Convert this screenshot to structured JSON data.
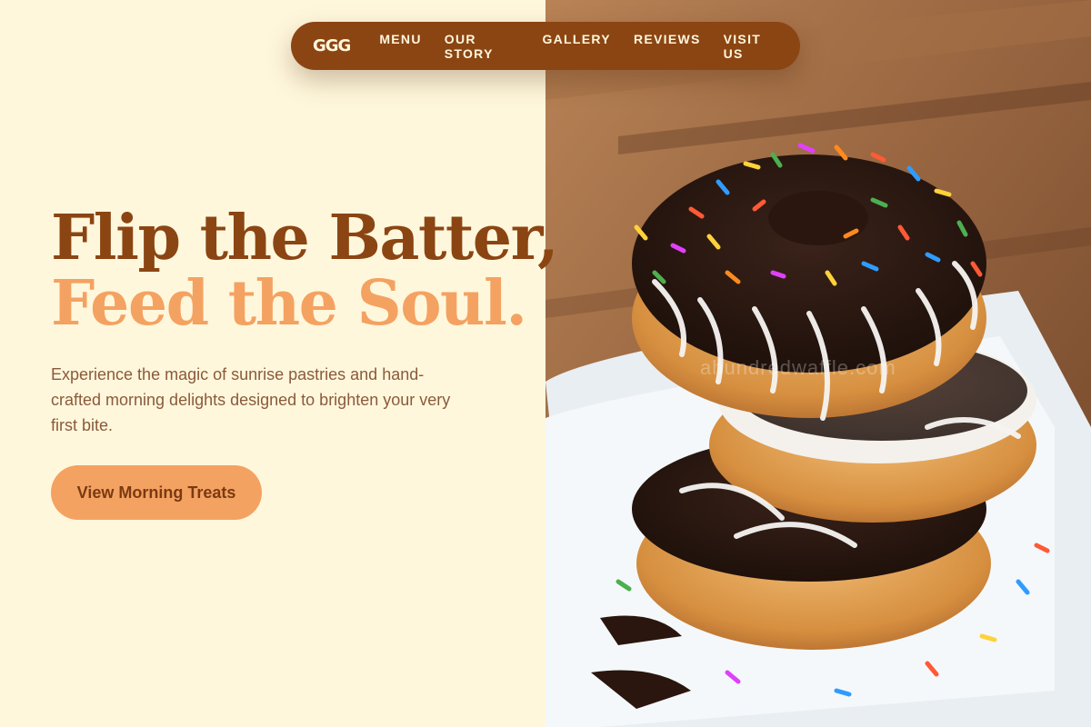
{
  "brand": {
    "logo": "GGG"
  },
  "nav": {
    "items": [
      {
        "label": "MENU"
      },
      {
        "label": "OUR STORY"
      },
      {
        "label": "GALLERY"
      },
      {
        "label": "REVIEWS"
      },
      {
        "label": "VISIT US"
      }
    ]
  },
  "hero": {
    "headline_line1": "Flip the Batter,",
    "headline_line2": "Feed the Soul.",
    "subtext": "Experience the magic of sunrise pastries and hand-crafted morning delights designed to brighten your very first bite.",
    "cta_label": "View Morning Treats",
    "photo_watermark": "ahundredwaffle.com",
    "photo_subject": "stacked-donuts-photo"
  },
  "colors": {
    "background": "#FFF7DC",
    "brand_brown": "#8B4513",
    "accent_orange": "#F4A261",
    "body_text": "#8B5A3A"
  }
}
